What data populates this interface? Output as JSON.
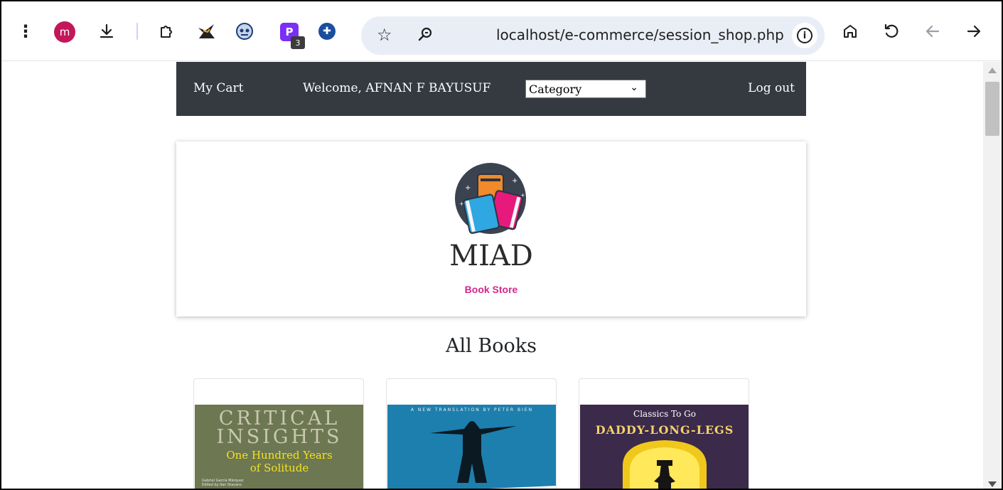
{
  "browser": {
    "profile_initial": "m",
    "extension_badge": "3",
    "extension_p_letter": "P",
    "url": "localhost/e-commerce/session_shop.php",
    "icons": [
      "menu-icon",
      "download-icon",
      "extensions-icon",
      "bookmark-star-icon",
      "zoom-icon",
      "site-info-icon",
      "home-icon",
      "reload-icon",
      "back-arrow-icon",
      "forward-arrow-icon"
    ]
  },
  "navbar": {
    "cart": "My Cart",
    "welcome": "Welcome, AFNAN F BAYUSUF",
    "category_selected": "Category",
    "logout": "Log out"
  },
  "brand": {
    "name": "MIAD",
    "tagline": "Book Store",
    "tagline_color": "#d6268a"
  },
  "section": {
    "title": "All Books"
  },
  "books": [
    {
      "cover_line1": "CRITICAL",
      "cover_line2": "INSIGHTS",
      "cover_line3": "One Hundred Years",
      "cover_line4": "of Solitude",
      "cover_author": "Gabriel García Márquez",
      "cover_editor": "Edited by Ilan Stavans"
    },
    {
      "cover_line1": "A NEW TRANSLATION BY PETER BIEN"
    },
    {
      "cover_line1": "Classics To Go",
      "cover_line2": "DADDY-LONG-LEGS"
    }
  ],
  "colors": {
    "navbar_bg": "#343a40",
    "omnibox_bg": "#e9eef6",
    "avatar_bg": "#c2185b"
  }
}
